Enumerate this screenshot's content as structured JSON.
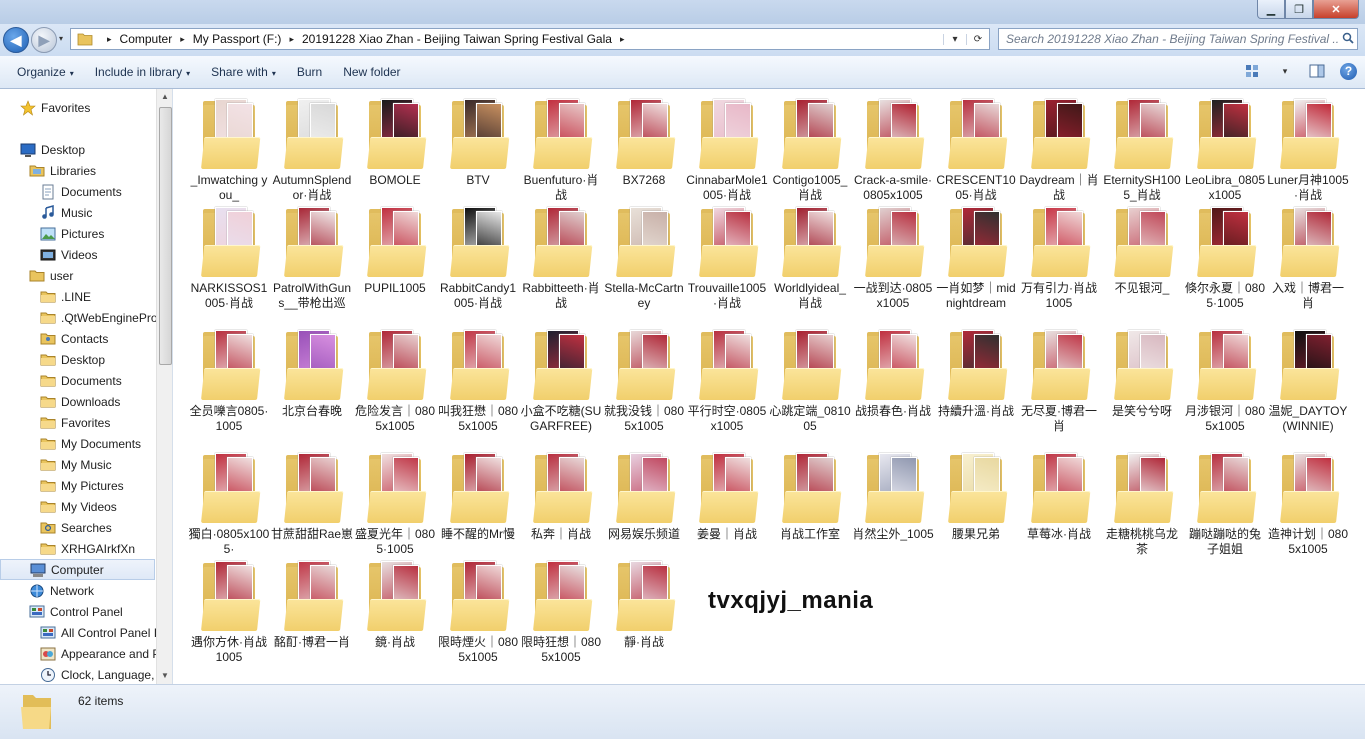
{
  "window": {
    "min_glyph": "▁",
    "max_glyph": "❐",
    "close_glyph": "✕"
  },
  "address": {
    "crumbs": [
      "Computer",
      "My Passport (F:)",
      "20191228 Xiao Zhan - Beijing Taiwan Spring Festival Gala"
    ],
    "separator": "▸",
    "refresh_glyph": "⟳",
    "dropdown_glyph": "▾"
  },
  "search": {
    "placeholder": "Search 20191228 Xiao Zhan - Beijing Taiwan Spring Festival ...",
    "icon": "search-icon"
  },
  "toolbar": {
    "items": [
      "Organize",
      "Include in library",
      "Share with",
      "Burn",
      "New folder"
    ],
    "dropdown_items": [
      true,
      true,
      true,
      false,
      false
    ],
    "caret": "▾"
  },
  "sidebar": {
    "items": [
      {
        "label": "Favorites",
        "icon": "star-icon",
        "indent": 0
      },
      {
        "label": "Desktop",
        "icon": "desktop-icon",
        "indent": 0
      },
      {
        "label": "Libraries",
        "icon": "libraries-icon",
        "indent": 1
      },
      {
        "label": "Documents",
        "icon": "documents-icon",
        "indent": 2
      },
      {
        "label": "Music",
        "icon": "music-icon",
        "indent": 2
      },
      {
        "label": "Pictures",
        "icon": "pictures-icon",
        "indent": 2
      },
      {
        "label": "Videos",
        "icon": "videos-icon",
        "indent": 2
      },
      {
        "label": "user",
        "icon": "user-icon",
        "indent": 1
      },
      {
        "label": ".LINE",
        "icon": "folder-icon",
        "indent": 2
      },
      {
        "label": ".QtWebEnginePro",
        "icon": "folder-icon",
        "indent": 2
      },
      {
        "label": "Contacts",
        "icon": "contacts-icon",
        "indent": 2
      },
      {
        "label": "Desktop",
        "icon": "folder-icon",
        "indent": 2
      },
      {
        "label": "Documents",
        "icon": "folder-icon",
        "indent": 2
      },
      {
        "label": "Downloads",
        "icon": "folder-icon",
        "indent": 2
      },
      {
        "label": "Favorites",
        "icon": "folder-icon",
        "indent": 2
      },
      {
        "label": "My Documents",
        "icon": "folder-icon",
        "indent": 2
      },
      {
        "label": "My Music",
        "icon": "folder-icon",
        "indent": 2
      },
      {
        "label": "My Pictures",
        "icon": "folder-icon",
        "indent": 2
      },
      {
        "label": "My Videos",
        "icon": "folder-icon",
        "indent": 2
      },
      {
        "label": "Searches",
        "icon": "searches-icon",
        "indent": 2
      },
      {
        "label": "XRHGAIrkfXn",
        "icon": "folder-icon",
        "indent": 2
      },
      {
        "label": "Computer",
        "icon": "computer-icon",
        "indent": 1,
        "selected": true
      },
      {
        "label": "Network",
        "icon": "network-icon",
        "indent": 1
      },
      {
        "label": "Control Panel",
        "icon": "control-panel-icon",
        "indent": 1
      },
      {
        "label": "All Control Panel I",
        "icon": "control-panel-icon",
        "indent": 2
      },
      {
        "label": "Appearance and P",
        "icon": "appearance-icon",
        "indent": 2
      },
      {
        "label": "Clock, Language,",
        "icon": "clock-icon",
        "indent": 2
      }
    ]
  },
  "folders": [
    {
      "name": "_Imwatching you_",
      "c1": "#e8d6d0",
      "c2": "#f3e2e6"
    },
    {
      "name": "AutumnSplendor·肖战",
      "c1": "#f0f0f0",
      "c2": "#d8d8d8"
    },
    {
      "name": "BOMOLE",
      "c1": "#1a1a1a",
      "c2": "#b33050"
    },
    {
      "name": "BTV",
      "c1": "#3a2a2a",
      "c2": "#c89060"
    },
    {
      "name": "Buenfuturo·肖战",
      "c1": "#c23040",
      "c2": "#e8c8c8"
    },
    {
      "name": "BX7268",
      "c1": "#b02838",
      "c2": "#f0e0e0"
    },
    {
      "name": "CinnabarMole1005·肖战",
      "c1": "#f0d8e0",
      "c2": "#e8b8c8"
    },
    {
      "name": "Contigo1005_肖战",
      "c1": "#a82030",
      "c2": "#e0d0d0"
    },
    {
      "name": "Crack-a-smile·0805x1005",
      "c1": "#e8e0e0",
      "c2": "#b02030"
    },
    {
      "name": "CRESCENT1005·肖战",
      "c1": "#b83040",
      "c2": "#e8d8d8"
    },
    {
      "name": "Daydream｜肖战",
      "c1": "#9a2030",
      "c2": "#401818"
    },
    {
      "name": "EternitySH1005_肖战",
      "c1": "#b02838",
      "c2": "#e8d8d8"
    },
    {
      "name": "LeoLibra_0805x1005",
      "c1": "#202020",
      "c2": "#c03040"
    },
    {
      "name": "Luner月神1005·肖战",
      "c1": "#f0f0f0",
      "c2": "#c02838"
    },
    {
      "name": "NARKISSOS1005·肖战",
      "c1": "#e8e0f0",
      "c2": "#f0d0d8"
    },
    {
      "name": "PatrolWithGuns__带枪出巡",
      "c1": "#a82838",
      "c2": "#f0e8e8"
    },
    {
      "name": "PUPIL1005",
      "c1": "#c03040",
      "c2": "#f0d8d8"
    },
    {
      "name": "RabbitCandy1005·肖战",
      "c1": "#101010",
      "c2": "#e8e8e8"
    },
    {
      "name": "Rabbitteeth·肖战",
      "c1": "#b02838",
      "c2": "#e0d0d0"
    },
    {
      "name": "Stella-McCartney",
      "c1": "#e8e0d8",
      "c2": "#c8b0a8"
    },
    {
      "name": "Trouvaille1005·肖战",
      "c1": "#f0d8e0",
      "c2": "#b83040"
    },
    {
      "name": "Worldlyideal_肖战",
      "c1": "#a02030",
      "c2": "#f0e0e0"
    },
    {
      "name": "一战到达·0805x1005",
      "c1": "#e0d0d0",
      "c2": "#b83040"
    },
    {
      "name": "一肖如梦｜midnightdream",
      "c1": "#b02838",
      "c2": "#303030"
    },
    {
      "name": "万有引力·肖战1005",
      "c1": "#c83848",
      "c2": "#f0d8d8"
    },
    {
      "name": "不见银河_",
      "c1": "#e8d0d0",
      "c2": "#c04858"
    },
    {
      "name": "倏尔永夏｜0805·1005",
      "c1": "#501818",
      "c2": "#c03040"
    },
    {
      "name": "入戏｜博君一肖",
      "c1": "#e8e0e0",
      "c2": "#b02838"
    },
    {
      "name": "全员嚛言0805·1005",
      "c1": "#b83040",
      "c2": "#f0e0e0"
    },
    {
      "name": "北京台春晚",
      "c1": "#9850b8",
      "c2": "#d890e0"
    },
    {
      "name": "危险发言｜0805x1005",
      "c1": "#b02838",
      "c2": "#e8d0d0"
    },
    {
      "name": "叫我狂懋｜0805x1005",
      "c1": "#c03848",
      "c2": "#f0d8d8"
    },
    {
      "name": "小盒不吃糖(SUGARFREE)",
      "c1": "#202030",
      "c2": "#c03040"
    },
    {
      "name": "就我没钱｜0805x1005",
      "c1": "#e8d8d8",
      "c2": "#b02838"
    },
    {
      "name": "平行时空·0805x1005",
      "c1": "#b83040",
      "c2": "#f0e0e0"
    },
    {
      "name": "心跳定端_081005",
      "c1": "#a82030",
      "c2": "#e8d0d0"
    },
    {
      "name": "战损春色·肖战",
      "c1": "#c03040",
      "c2": "#f0e0e0"
    },
    {
      "name": "持續升溫·肖战",
      "c1": "#b02838",
      "c2": "#303030"
    },
    {
      "name": "无尽夏·博君一肖",
      "c1": "#e8e0e0",
      "c2": "#c03848"
    },
    {
      "name": "是笑兮兮呀",
      "c1": "#f0e8e8",
      "c2": "#d8b8c0"
    },
    {
      "name": "月涉银河｜0805x1005",
      "c1": "#b83040",
      "c2": "#f0d8d8"
    },
    {
      "name": "温妮_DAYTOY(WINNIE)",
      "c1": "#101010",
      "c2": "#802030"
    },
    {
      "name": "獨白·0805x1005·",
      "c1": "#c03040",
      "c2": "#f0e0e0"
    },
    {
      "name": "甘蔗甜甜Rae崽",
      "c1": "#b02838",
      "c2": "#e8d0d0"
    },
    {
      "name": "盛夏光年｜0805·1005",
      "c1": "#f0e0e0",
      "c2": "#c03848"
    },
    {
      "name": "睡不醒的Mr慢",
      "c1": "#a82030",
      "c2": "#f0e0e0"
    },
    {
      "name": "私奔｜肖战",
      "c1": "#b83040",
      "c2": "#e8d8d8"
    },
    {
      "name": "网易娱乐频道",
      "c1": "#e8d0e0",
      "c2": "#c04860"
    },
    {
      "name": "姜曼｜肖战",
      "c1": "#c03040",
      "c2": "#f0e0e0"
    },
    {
      "name": "肖战工作室",
      "c1": "#b02838",
      "c2": "#e0d0d0"
    },
    {
      "name": "肖然尘外_1005",
      "c1": "#e8e8f0",
      "c2": "#9098b0"
    },
    {
      "name": "腰果兄弟",
      "c1": "#f8f0d0",
      "c2": "#e8d8a0"
    },
    {
      "name": "草莓冰·肖战",
      "c1": "#c03848",
      "c2": "#f0d8d8"
    },
    {
      "name": "走糖桃桃乌龙茶",
      "c1": "#f0f0f0",
      "c2": "#b02838"
    },
    {
      "name": "蹦哒蹦哒的兔子姐姐",
      "c1": "#b83040",
      "c2": "#e8d8d8"
    },
    {
      "name": "造神计划｜0805x1005",
      "c1": "#e8e0e0",
      "c2": "#c03040"
    },
    {
      "name": "遇你方休·肖战1005",
      "c1": "#b02838",
      "c2": "#f0e0e0"
    },
    {
      "name": "酩酊·博君一肖",
      "c1": "#c03848",
      "c2": "#e8d8d8"
    },
    {
      "name": "鏡·肖战",
      "c1": "#e8e0e0",
      "c2": "#b83040"
    },
    {
      "name": "限時煙火｜0805x1005",
      "c1": "#b02838",
      "c2": "#f0d8d8"
    },
    {
      "name": "限時狂想｜0805x1005",
      "c1": "#c03040",
      "c2": "#e8e0e0"
    },
    {
      "name": "靜·肖战",
      "c1": "#e8d8e0",
      "c2": "#b83040"
    }
  ],
  "watermark": "tvxqjyj_mania",
  "status": {
    "count": "62 items"
  }
}
